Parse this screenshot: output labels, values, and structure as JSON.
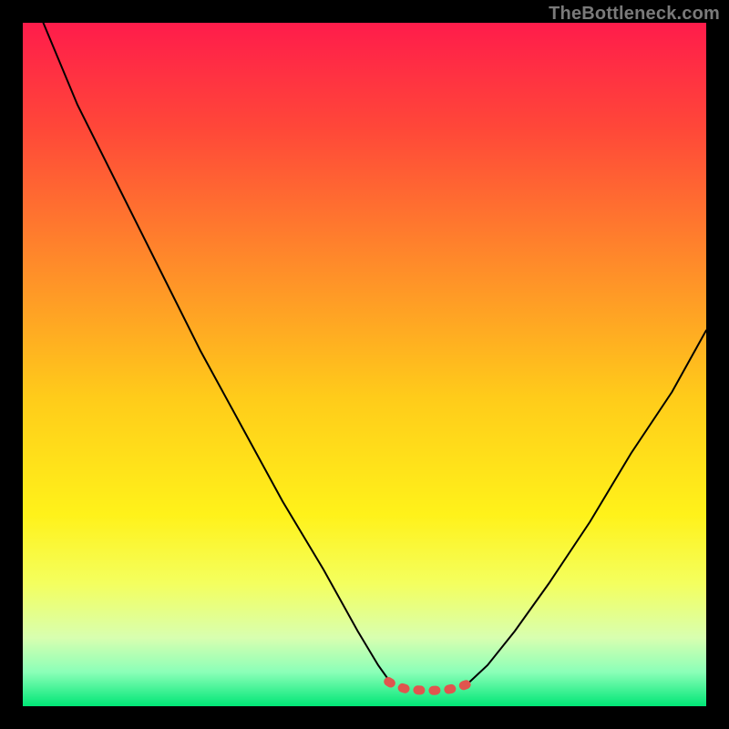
{
  "watermark": "TheBottleneck.com",
  "chart_data": {
    "type": "line",
    "title": "",
    "xlabel": "",
    "ylabel": "",
    "xlim": [
      0,
      100
    ],
    "ylim": [
      0,
      100
    ],
    "grid": false,
    "legend": false,
    "annotations": [],
    "background_gradient": {
      "stops": [
        {
          "pct": 0,
          "color": "#ff1c4b"
        },
        {
          "pct": 15,
          "color": "#ff4639"
        },
        {
          "pct": 35,
          "color": "#ff8a2a"
        },
        {
          "pct": 55,
          "color": "#ffcc1a"
        },
        {
          "pct": 72,
          "color": "#fff21a"
        },
        {
          "pct": 82,
          "color": "#f4ff5e"
        },
        {
          "pct": 90,
          "color": "#d8ffb0"
        },
        {
          "pct": 95,
          "color": "#8bffb8"
        },
        {
          "pct": 100,
          "color": "#00e676"
        }
      ]
    },
    "series": [
      {
        "name": "left-branch",
        "style": "thin-black",
        "points": [
          {
            "x": 3,
            "y": 100
          },
          {
            "x": 8,
            "y": 88
          },
          {
            "x": 14,
            "y": 76
          },
          {
            "x": 20,
            "y": 64
          },
          {
            "x": 26,
            "y": 52
          },
          {
            "x": 32,
            "y": 41
          },
          {
            "x": 38,
            "y": 30
          },
          {
            "x": 44,
            "y": 20
          },
          {
            "x": 49,
            "y": 11
          },
          {
            "x": 52,
            "y": 6
          },
          {
            "x": 54,
            "y": 3.2
          }
        ]
      },
      {
        "name": "right-branch",
        "style": "thin-black",
        "points": [
          {
            "x": 65,
            "y": 3.2
          },
          {
            "x": 68,
            "y": 6
          },
          {
            "x": 72,
            "y": 11
          },
          {
            "x": 77,
            "y": 18
          },
          {
            "x": 83,
            "y": 27
          },
          {
            "x": 89,
            "y": 37
          },
          {
            "x": 95,
            "y": 46
          },
          {
            "x": 100,
            "y": 55
          }
        ]
      },
      {
        "name": "bottom-trough",
        "style": "thick-red-dashed",
        "points": [
          {
            "x": 53.5,
            "y": 3.6
          },
          {
            "x": 54.5,
            "y": 3.0
          },
          {
            "x": 56,
            "y": 2.55
          },
          {
            "x": 58,
            "y": 2.35
          },
          {
            "x": 60,
            "y": 2.3
          },
          {
            "x": 62,
            "y": 2.4
          },
          {
            "x": 63.5,
            "y": 2.7
          },
          {
            "x": 65,
            "y": 3.2
          },
          {
            "x": 65.8,
            "y": 3.7
          }
        ]
      }
    ]
  }
}
